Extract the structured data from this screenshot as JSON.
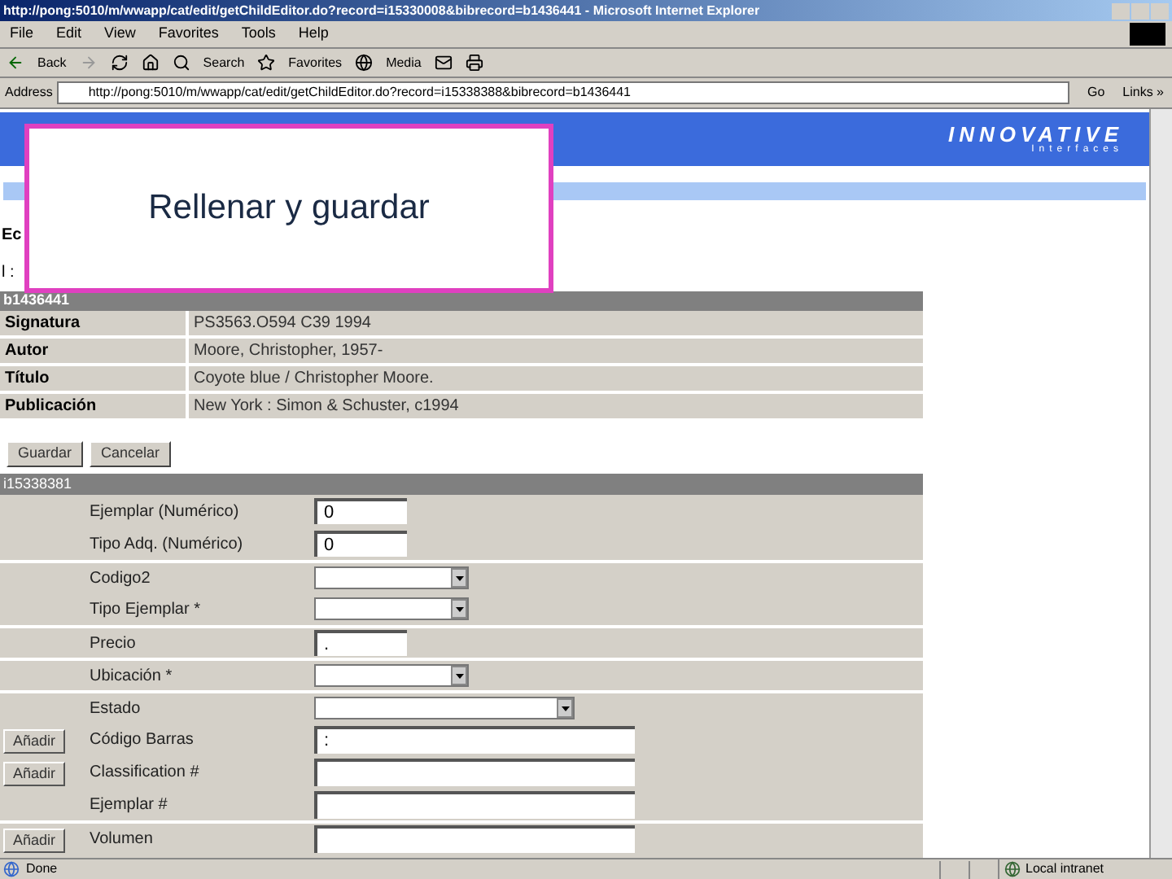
{
  "window": {
    "title": "http://pong:5010/m/wwapp/cat/edit/getChildEditor.do?record=i15330008&bibrecord=b1436441 - Microsoft Internet Explorer"
  },
  "menu": [
    "File",
    "Edit",
    "View",
    "Favorites",
    "Tools",
    "Help"
  ],
  "toolbar": [
    "Back",
    "Search",
    "Favorites",
    "Media"
  ],
  "address": {
    "label": "Address",
    "value": "http://pong:5010/m/wwapp/cat/edit/getChildEditor.do?record=i15338388&bibrecord=b1436441",
    "go": "Go",
    "links": "Links »"
  },
  "banner": {
    "logo": "INNOVATIVE",
    "logo_sub": "Interfaces"
  },
  "page": {
    "heading": "Ec",
    "line": "l :",
    "bib_record": "b1436441"
  },
  "bib_rows": [
    {
      "label": "Signatura",
      "value": "PS3563.O594 C39 1994"
    },
    {
      "label": "Autor",
      "value": "Moore, Christopher, 1957-"
    },
    {
      "label": "Título",
      "value": "Coyote blue / Christopher Moore."
    },
    {
      "label": "Publicación",
      "value": "New York : Simon & Schuster, c1994"
    }
  ],
  "buttons": [
    "Guardar",
    "Cancelar"
  ],
  "item_record": "i15338381",
  "fields": [
    {
      "label": "Ejemplar (Numérico)",
      "kind": "short",
      "value": "0",
      "divider_above": false
    },
    {
      "label": "Tipo Adq. (Numérico)",
      "kind": "short",
      "value": "0",
      "divider_above": false
    },
    {
      "label": "Codigo2",
      "kind": "select",
      "divider_above": true
    },
    {
      "label": "Tipo Ejemplar *",
      "kind": "select",
      "divider_above": false
    },
    {
      "label": "Precio",
      "kind": "short",
      "value": ".",
      "divider_above": true
    },
    {
      "label": "Ubicación *",
      "kind": "select",
      "divider_above": true
    },
    {
      "label": "Estado",
      "kind": "wideselect",
      "divider_above": true
    },
    {
      "label": "Código Barras",
      "kind": "long",
      "value": ":",
      "add": "Añadir",
      "divider_above": false
    },
    {
      "label": "Classification #",
      "kind": "long",
      "add": "Añadir",
      "divider_above": false
    },
    {
      "label": "Ejemplar #",
      "kind": "long",
      "divider_above": false
    },
    {
      "label": "Volumen",
      "kind": "long",
      "add": "Añadir",
      "divider_above": true
    }
  ],
  "popup": {
    "text": "Rellenar y guardar"
  },
  "status_bar": {
    "text": "Done",
    "zone": "Local intranet"
  }
}
